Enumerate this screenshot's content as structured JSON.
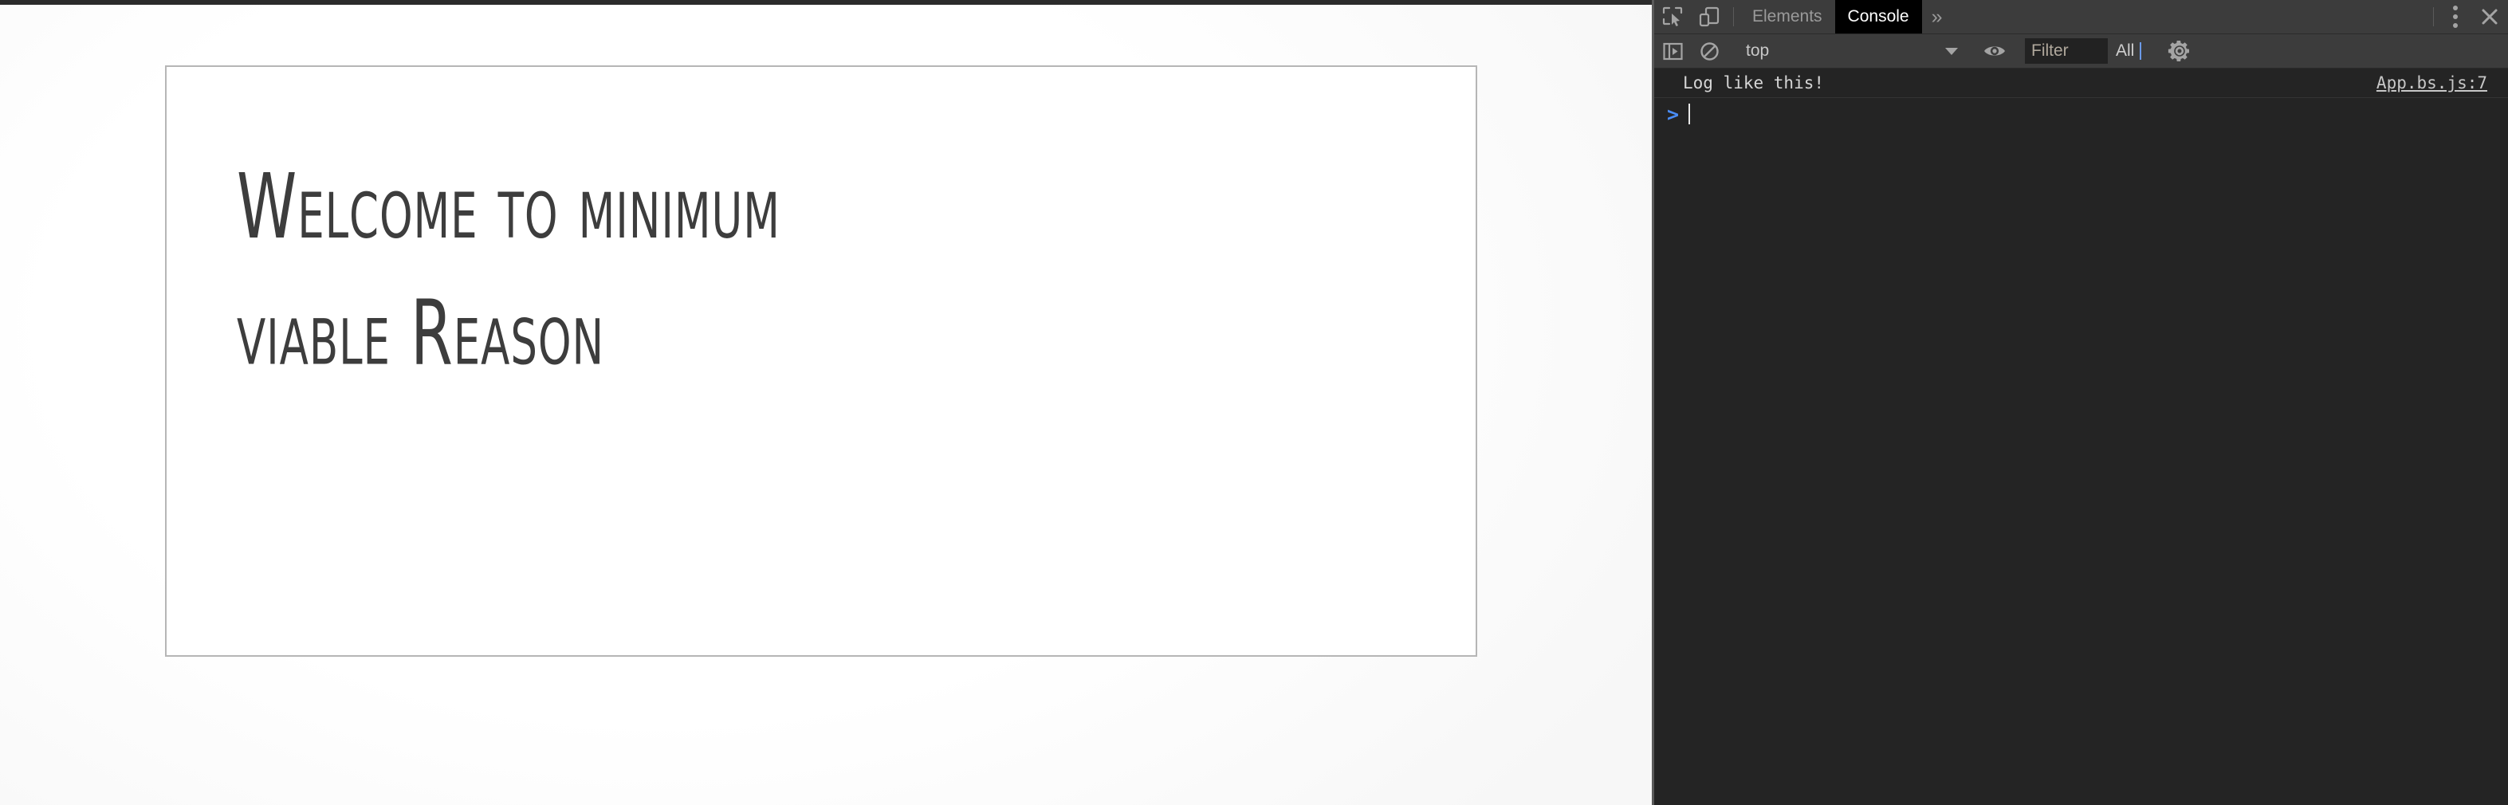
{
  "page": {
    "card": {
      "heading_line1": "Welcome to minimum",
      "heading_line2": "viable Reason"
    }
  },
  "devtools": {
    "tabbar": {
      "inspect_icon": "inspect-cursor-icon",
      "device_icon": "device-toolbar-icon",
      "tabs": [
        {
          "label": "Elements",
          "selected": false
        },
        {
          "label": "Console",
          "selected": true
        }
      ],
      "more_tabs_label": "»",
      "menu_icon": "kebab-menu-icon",
      "close_label": "✕"
    },
    "toolbar": {
      "sidebar_toggle_icon": "console-sidebar-toggle-icon",
      "clear_icon": "clear-console-icon",
      "context_value": "top",
      "context_caret": "chevron-down-icon",
      "eye_icon": "live-expression-eye-icon",
      "filter_placeholder": "Filter",
      "filter_value": "",
      "level_value": "All",
      "settings_icon": "settings-gear-icon"
    },
    "console": {
      "messages": [
        {
          "text": "Log like this!",
          "source": "App.bs.js:7"
        }
      ],
      "prompt_symbol": ">",
      "prompt_value": ""
    }
  },
  "colors": {
    "devtools_header": "#3c3c3c",
    "devtools_body": "#242424",
    "selected_tab": "#000000",
    "prompt_blue": "#4a8df6",
    "heading_text": "#3d3d3d",
    "card_border": "#b6b6b6"
  }
}
